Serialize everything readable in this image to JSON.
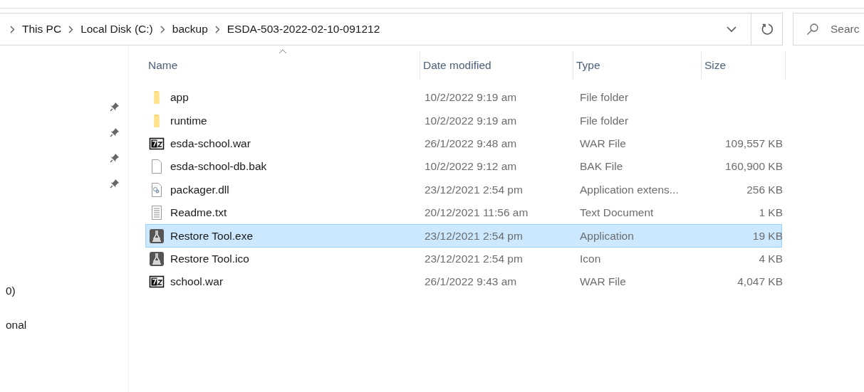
{
  "address_bar": {
    "breadcrumbs": [
      "This PC",
      "Local Disk (C:)",
      "backup",
      "ESDA-503-2022-02-10-091212"
    ]
  },
  "search": {
    "placeholder": "Searc"
  },
  "sidebar": {
    "items": [
      {
        "kind": "pinned"
      },
      {
        "kind": "pinned"
      },
      {
        "kind": "pinned"
      },
      {
        "kind": "pinned"
      },
      {
        "kind": "text",
        "label": "0)"
      },
      {
        "kind": "text",
        "label": "onal"
      }
    ]
  },
  "table": {
    "columns": [
      {
        "label": "Name",
        "sorted": true
      },
      {
        "label": "Date modified",
        "sorted": false
      },
      {
        "label": "Type",
        "sorted": false
      },
      {
        "label": "Size",
        "sorted": false
      }
    ],
    "rows": [
      {
        "kind": "folder",
        "name": "app",
        "date": "10/2/2022 9:19 am",
        "type": "File folder",
        "selected": false
      },
      {
        "kind": "folder",
        "name": "runtime",
        "date": "10/2/2022 9:19 am",
        "type": "File folder",
        "selected": false
      },
      {
        "kind": "archive",
        "name": "esda-school.war",
        "date": "26/1/2022 9:48 am",
        "type": "WAR File",
        "size": "109,557 KB",
        "selected": false
      },
      {
        "kind": "blank",
        "name": "esda-school-db.bak",
        "date": "10/2/2022 9:12 am",
        "type": "BAK File",
        "size": "160,900 KB",
        "selected": false
      },
      {
        "kind": "dll",
        "name": "packager.dll",
        "date": "23/12/2021 2:54 pm",
        "type": "Application extens...",
        "size": "256 KB",
        "selected": false
      },
      {
        "kind": "text",
        "name": "Readme.txt",
        "date": "20/12/2021 11:56 am",
        "type": "Text Document",
        "size": "1 KB",
        "selected": false
      },
      {
        "kind": "app",
        "name": "Restore Tool.exe",
        "date": "23/12/2021 2:54 pm",
        "type": "Application",
        "size": "19 KB",
        "selected": true
      },
      {
        "kind": "app",
        "name": "Restore Tool.ico",
        "date": "23/12/2021 2:54 pm",
        "type": "Icon",
        "size": "4 KB",
        "selected": false
      },
      {
        "kind": "archive",
        "name": "school.war",
        "date": "26/1/2022 9:43 am",
        "type": "WAR File",
        "size": "4,047 KB",
        "selected": false
      }
    ]
  }
}
